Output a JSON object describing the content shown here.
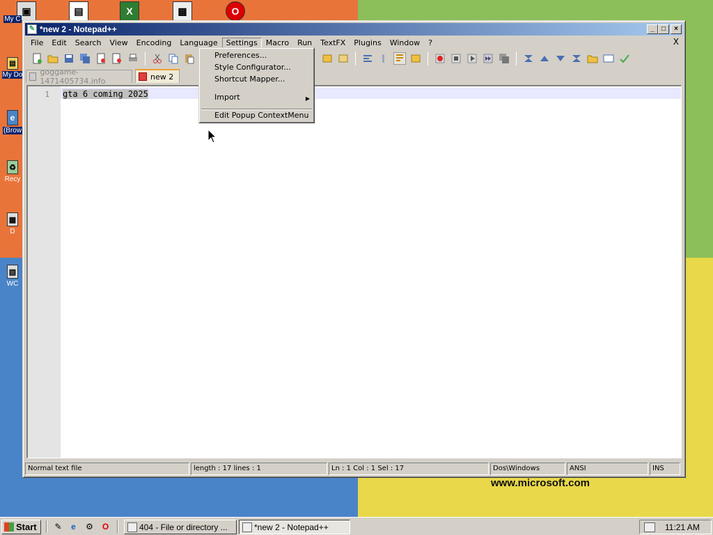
{
  "desktop": {
    "wallpaper_text": "www.microsoft.com",
    "icons": [
      {
        "label": "My C",
        "glyph": "▣"
      },
      {
        "label": "My Do",
        "glyph": "▤"
      },
      {
        "label": "(Brow",
        "glyph": "e"
      },
      {
        "label": "Recy",
        "glyph": "♻"
      },
      {
        "label": "D",
        "glyph": "▦"
      },
      {
        "label": "WC",
        "glyph": "▧"
      }
    ],
    "top_icons": [
      {
        "glyph": "▣"
      },
      {
        "glyph": "X"
      },
      {
        "glyph": "▩"
      },
      {
        "glyph": "O"
      }
    ]
  },
  "window": {
    "title": "*new  2 - Notepad++",
    "buttons": {
      "minimize": "_",
      "maximize": "□",
      "close": "×"
    },
    "menu": [
      {
        "label": "File"
      },
      {
        "label": "Edit"
      },
      {
        "label": "Search"
      },
      {
        "label": "View"
      },
      {
        "label": "Encoding"
      },
      {
        "label": "Language"
      },
      {
        "label": "Settings"
      },
      {
        "label": "Macro"
      },
      {
        "label": "Run"
      },
      {
        "label": "TextFX"
      },
      {
        "label": "Plugins"
      },
      {
        "label": "Window"
      },
      {
        "label": "?"
      }
    ],
    "menu_close": "X",
    "tabs": [
      {
        "label": "goggame-1471405734.info"
      },
      {
        "label": "new  2"
      }
    ],
    "editor": {
      "line_number": "1",
      "text": "gta 6 coming 2025"
    },
    "status": {
      "file_type": "Normal text file",
      "length": "length : 17    lines : 1",
      "position": "Ln : 1    Col : 1    Sel : 17",
      "eol": "Dos\\Windows",
      "encoding": "ANSI",
      "mode": "INS"
    }
  },
  "settings_menu": {
    "items": [
      {
        "label": "Preferences..."
      },
      {
        "label": "Style Configurator..."
      },
      {
        "label": "Shortcut Mapper..."
      },
      {
        "label": "Import"
      },
      {
        "label": "Edit Popup ContextMenu"
      }
    ],
    "submenu_arrow": "▶"
  },
  "taskbar": {
    "start_label": "Start",
    "quick_launch": [
      "✎",
      "e",
      "⚙",
      "O"
    ],
    "tasks": [
      {
        "label": "404 - File or directory ..."
      },
      {
        "label": "*new  2 - Notepad++"
      }
    ],
    "clock": "11:21 AM"
  }
}
